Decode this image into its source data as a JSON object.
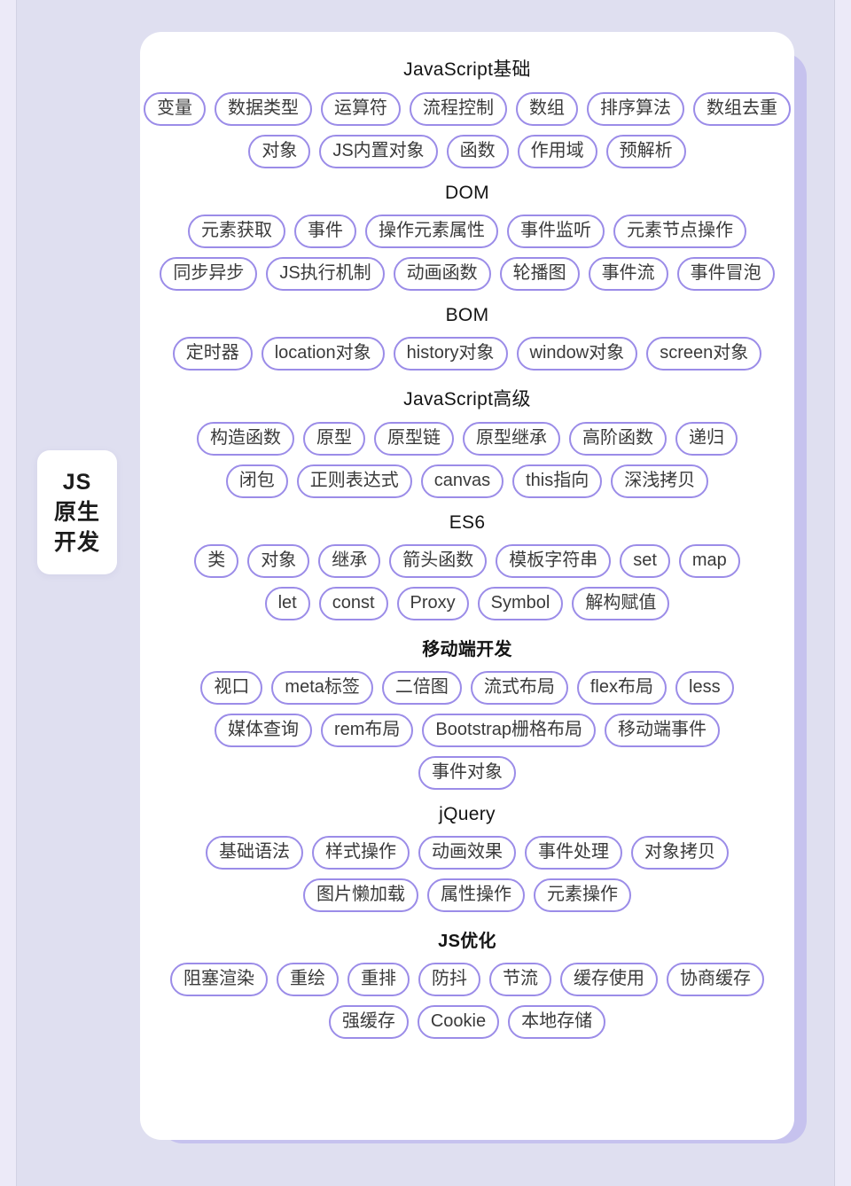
{
  "theme": {
    "page_background": "#dfdff0",
    "card_background": "#ffffff",
    "accent_purple": "#c6c2ee",
    "chip_border": "#9b8ce8",
    "chip_text": "#3a3a3a",
    "title_text": "#141414"
  },
  "side_badge": {
    "lines": [
      "JS",
      "原生",
      "开发"
    ]
  },
  "sections": [
    {
      "title": "JavaScript基础",
      "bold": false,
      "rows": [
        [
          "变量",
          "数据类型",
          "运算符",
          "流程控制",
          "数组",
          "排序算法",
          "数组去重"
        ],
        [
          "对象",
          "JS内置对象",
          "函数",
          "作用域",
          "预解析"
        ]
      ]
    },
    {
      "title": "DOM",
      "bold": false,
      "rows": [
        [
          "元素获取",
          "事件",
          "操作元素属性",
          "事件监听",
          "元素节点操作"
        ],
        [
          "同步异步",
          "JS执行机制",
          "动画函数",
          "轮播图",
          "事件流",
          "事件冒泡"
        ]
      ]
    },
    {
      "title": "BOM",
      "bold": false,
      "rows": [
        [
          "定时器",
          "location对象",
          "history对象",
          "window对象",
          "screen对象"
        ]
      ]
    },
    {
      "title": "JavaScript高级",
      "bold": false,
      "rows": [
        [
          "构造函数",
          "原型",
          "原型链",
          "原型继承",
          "高阶函数",
          "递归"
        ],
        [
          "闭包",
          "正则表达式",
          "canvas",
          "this指向",
          "深浅拷贝"
        ]
      ]
    },
    {
      "title": "ES6",
      "bold": false,
      "rows": [
        [
          "类",
          "对象",
          "继承",
          "箭头函数",
          "模板字符串",
          "set",
          "map"
        ],
        [
          "let",
          "const",
          "Proxy",
          "Symbol",
          "解构赋值"
        ]
      ]
    },
    {
      "title": "移动端开发",
      "bold": true,
      "rows": [
        [
          "视口",
          "meta标签",
          "二倍图",
          "流式布局",
          "flex布局",
          "less"
        ],
        [
          "媒体查询",
          "rem布局",
          "Bootstrap栅格布局",
          "移动端事件"
        ],
        [
          "事件对象"
        ]
      ]
    },
    {
      "title": "jQuery",
      "bold": false,
      "rows": [
        [
          "基础语法",
          "样式操作",
          "动画效果",
          "事件处理",
          "对象拷贝"
        ],
        [
          "图片懒加载",
          "属性操作",
          "元素操作"
        ]
      ]
    },
    {
      "title": "JS优化",
      "bold": true,
      "rows": [
        [
          "阻塞渲染",
          "重绘",
          "重排",
          "防抖",
          "节流",
          "缓存使用",
          "协商缓存"
        ],
        [
          "强缓存",
          "Cookie",
          "本地存储"
        ]
      ]
    }
  ]
}
